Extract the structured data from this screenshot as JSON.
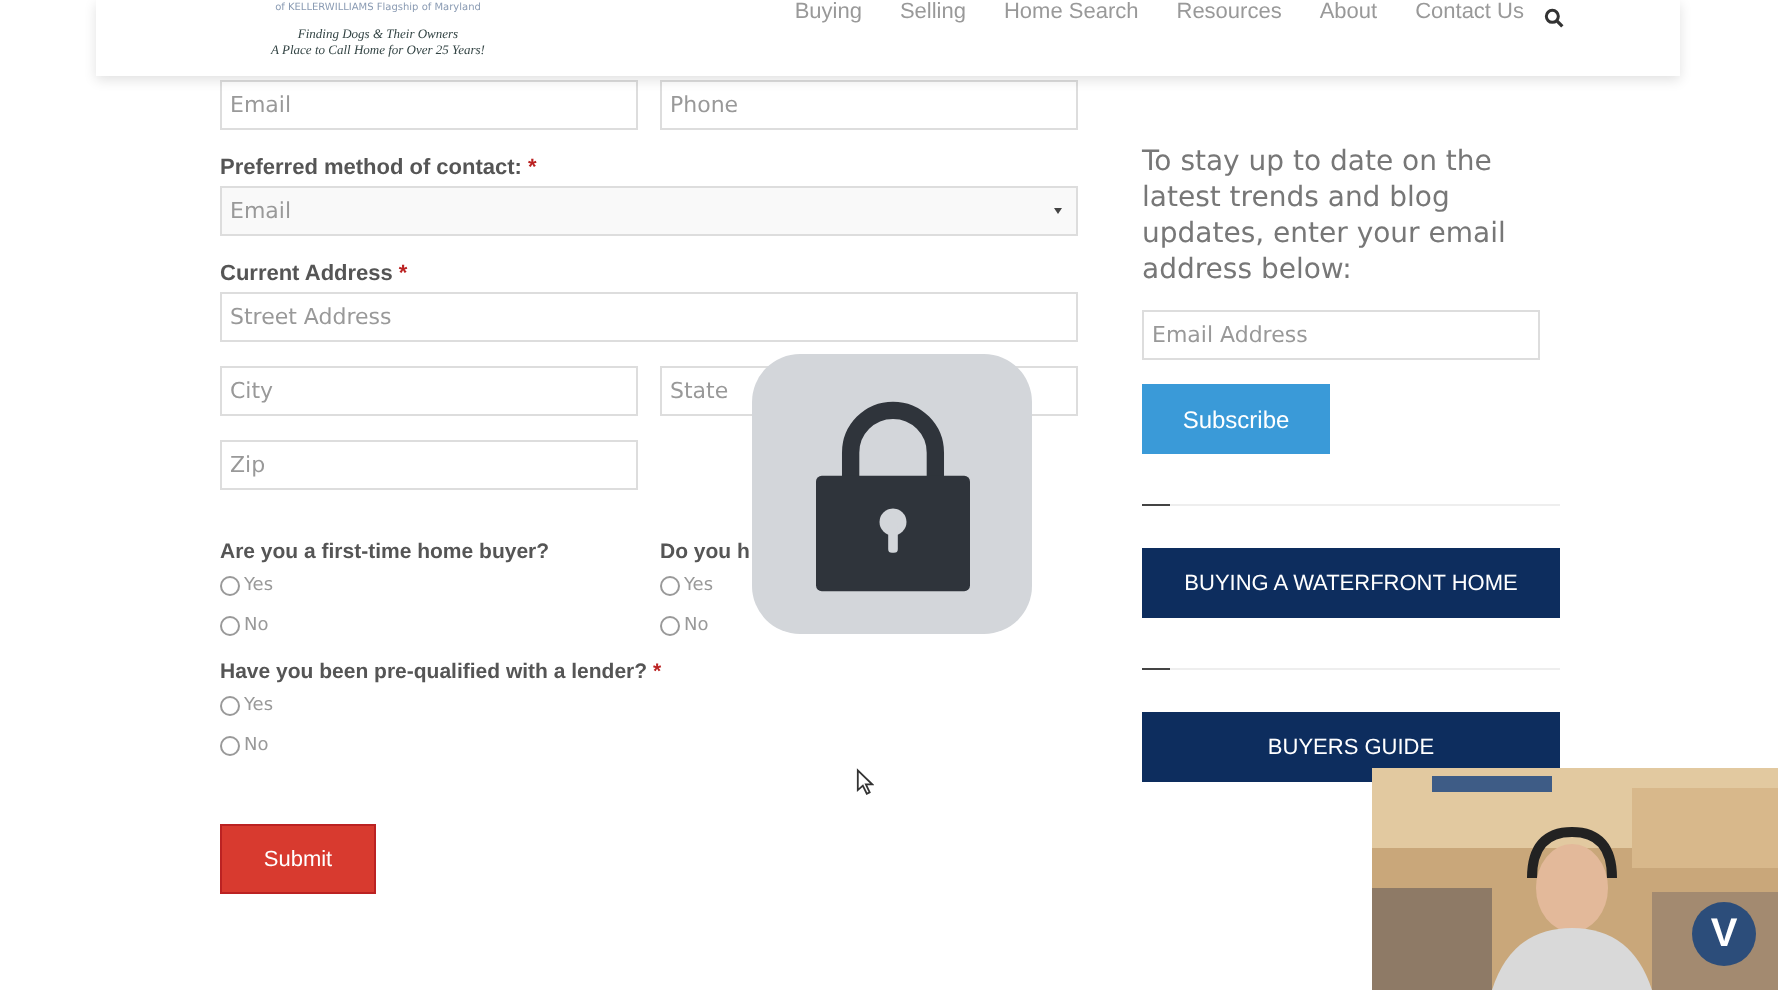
{
  "header": {
    "logo_lines": [
      "of KELLERWILLIAMS Flagship of Maryland",
      "Finding Dogs & Their Owners",
      "A Place to Call Home for Over 25 Years!"
    ],
    "nav": [
      {
        "label": "Buying"
      },
      {
        "label": "Selling"
      },
      {
        "label": "Home Search"
      },
      {
        "label": "Resources"
      },
      {
        "label": "About"
      },
      {
        "label": "Contact Us"
      }
    ]
  },
  "form": {
    "top_fields": [
      {
        "placeholder": "Email"
      },
      {
        "placeholder": "Phone"
      }
    ],
    "contact": {
      "label": "Preferred method of contact:",
      "required_mark": "*",
      "value": "Email"
    },
    "address": {
      "label": "Current Address",
      "required_mark": "*",
      "street": {
        "placeholder": "Street Address"
      },
      "city": {
        "placeholder": "City"
      },
      "state": {
        "placeholder": "State"
      },
      "zip": {
        "placeholder": "Zip"
      }
    },
    "question_pairs": [
      [
        {
          "label": "Are you a first-time home buyer?",
          "options": [
            {
              "label": "Yes",
              "selected": false
            },
            {
              "label": "No",
              "selected": false
            }
          ]
        },
        {
          "label": "Do you h",
          "options": [
            {
              "label": "Yes",
              "selected": false
            },
            {
              "label": "No",
              "selected": false
            }
          ]
        }
      ],
      [
        {
          "label": "Have you been pre-qualified with a lender?",
          "required_mark": "*",
          "options": [
            {
              "label": "Yes",
              "selected": false
            },
            {
              "label": "No",
              "selected": false
            }
          ]
        }
      ]
    ],
    "submit": "Submit"
  },
  "sidebar": {
    "text": "To stay up to date on the latest trends and blog updates, enter your email address below:",
    "email": {
      "placeholder": "Email Address"
    },
    "subscribe": "Subscribe",
    "links": [
      "BUYING A WATERFRONT HOME",
      "BUYERS GUIDE"
    ]
  },
  "overlay": {
    "locked": true
  },
  "webcam": {
    "kind": "picture",
    "badge": "V"
  }
}
